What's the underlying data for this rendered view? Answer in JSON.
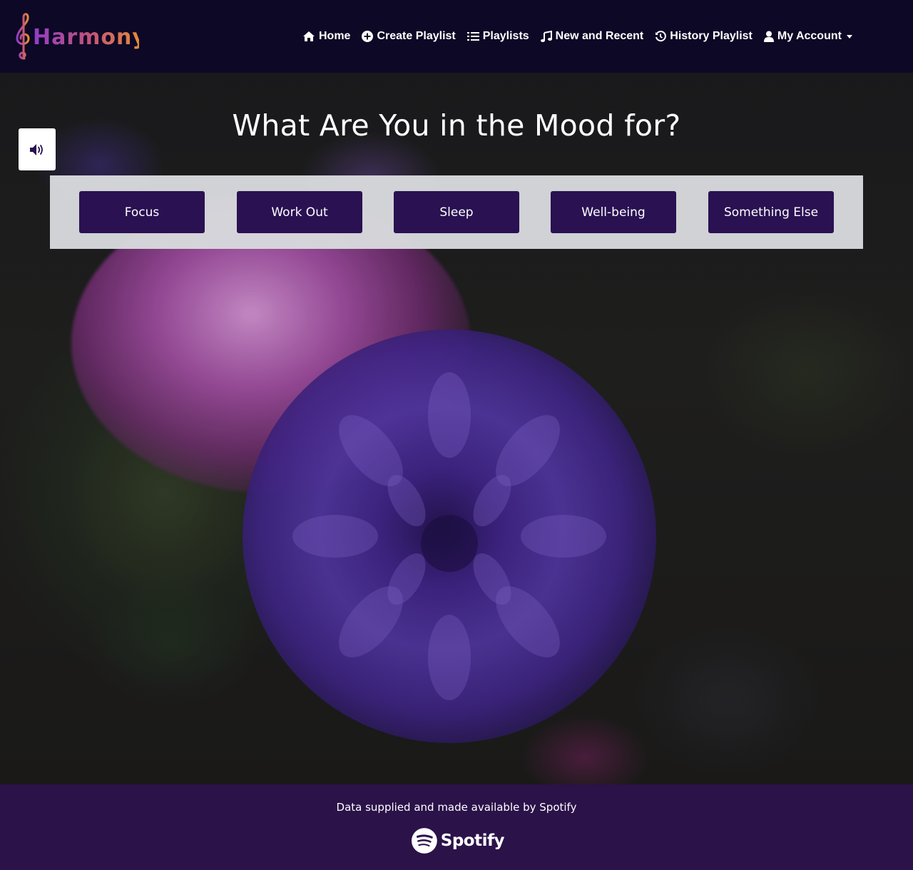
{
  "brand": {
    "name": "Harmony",
    "colors": [
      "#8e3fc4",
      "#e07a2e"
    ]
  },
  "nav": {
    "items": [
      {
        "label": "Home",
        "icon": "home-icon"
      },
      {
        "label": "Create Playlist",
        "icon": "plus-circle-icon"
      },
      {
        "label": "Playlists",
        "icon": "list-icon"
      },
      {
        "label": "New and Recent",
        "icon": "music-note-icon"
      },
      {
        "label": "History Playlist",
        "icon": "history-icon"
      },
      {
        "label": "My Account",
        "icon": "user-icon",
        "dropdown": true
      }
    ]
  },
  "hero": {
    "title": "What Are You in the Mood for?",
    "sound_icon": "volume-icon"
  },
  "moods": [
    {
      "label": "Focus"
    },
    {
      "label": "Work Out"
    },
    {
      "label": "Sleep"
    },
    {
      "label": "Well-being"
    },
    {
      "label": "Something Else"
    }
  ],
  "footer": {
    "attribution": "Data supplied and made available by Spotify",
    "spotify_logo_text": "Spotify"
  },
  "colors": {
    "navbar_bg": "#0c0826",
    "button_bg": "#2a1152",
    "footer_bg": "#2b1249",
    "panel_bg": "#d7d9dc"
  }
}
